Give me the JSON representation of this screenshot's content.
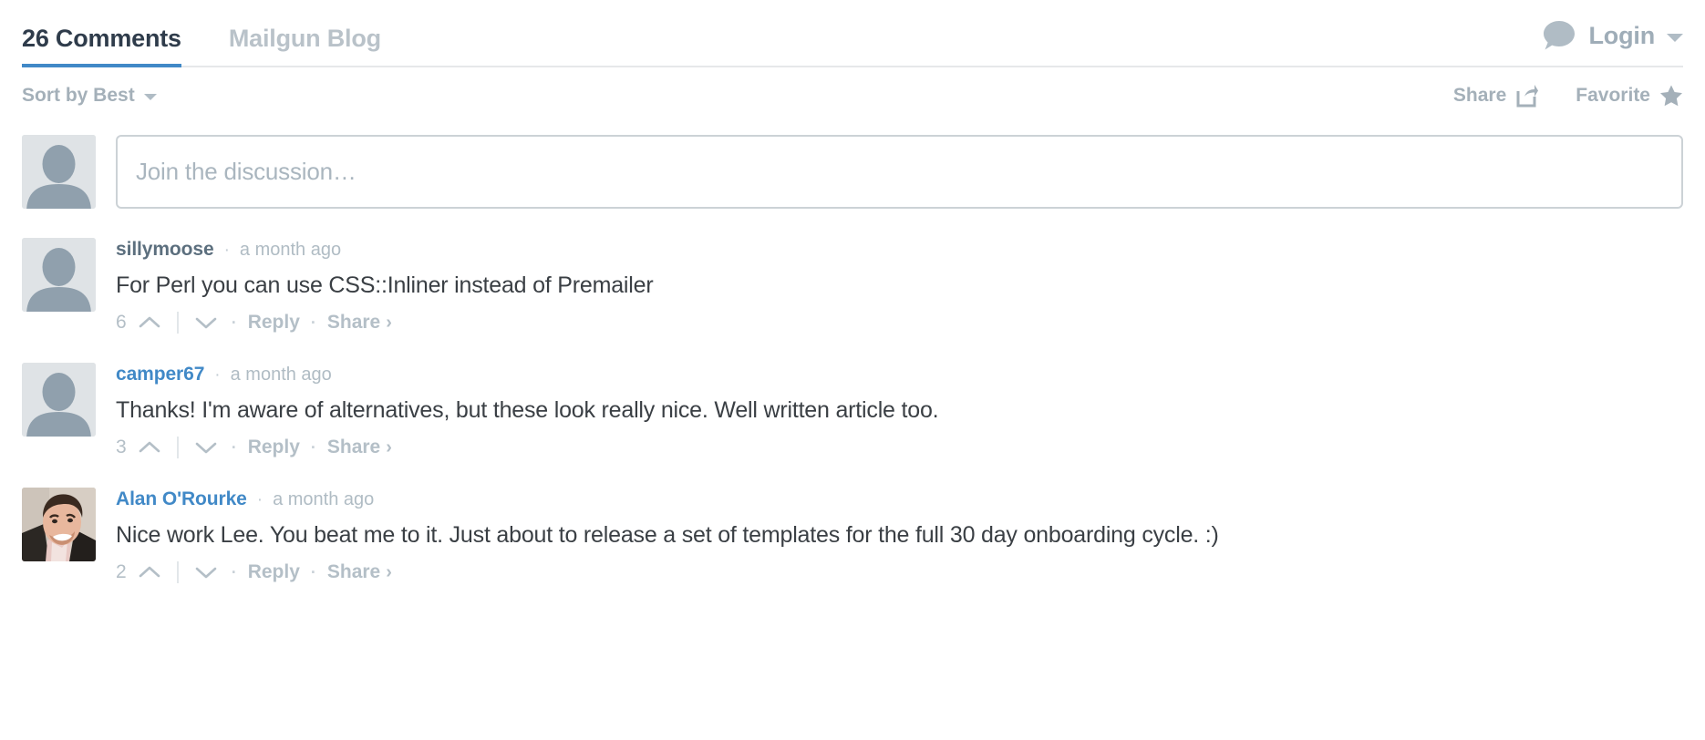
{
  "header": {
    "tabs": [
      {
        "label": "26 Comments",
        "state": "active"
      },
      {
        "label": "Mailgun Blog",
        "state": "inactive"
      }
    ],
    "login": {
      "label": "Login",
      "icon": "speech-bubble-icon",
      "caret": "chevron-down-icon"
    },
    "accent_color": "#4189c7"
  },
  "toolbar": {
    "sort_label": "Sort by Best",
    "share_label": "Share",
    "share_icon": "share-export-icon",
    "favorite_label": "Favorite",
    "favorite_icon": "star-icon"
  },
  "composer": {
    "placeholder": "Join the discussion…",
    "avatar": "default-avatar-icon"
  },
  "actions": {
    "upvote_icon": "chevron-up-icon",
    "downvote_icon": "chevron-down-icon",
    "reply_label": "Reply",
    "share_label": "Share",
    "share_caret": "›",
    "separator": "·"
  },
  "comments": [
    {
      "author": "sillymoose",
      "author_is_link": false,
      "timestamp": "a month ago",
      "text": "For Perl you can use CSS::Inliner instead of Premailer",
      "votes": "6",
      "avatar_type": "default"
    },
    {
      "author": "camper67",
      "author_is_link": true,
      "timestamp": "a month ago",
      "text": "Thanks! I'm aware of alternatives, but these look really nice. Well written article too.",
      "votes": "3",
      "avatar_type": "default"
    },
    {
      "author": "Alan O'Rourke",
      "author_is_link": true,
      "timestamp": "a month ago",
      "text": "Nice work Lee. You beat me to it. Just about to release a set of templates for the full 30 day onboarding cycle. :)",
      "votes": "2",
      "avatar_type": "photo"
    }
  ]
}
